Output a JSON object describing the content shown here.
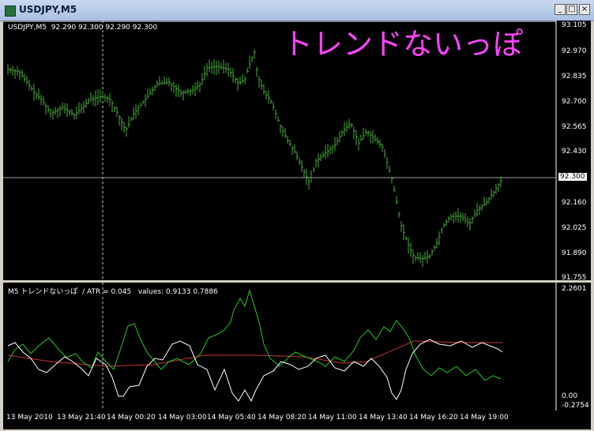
{
  "window": {
    "title": "USDJPY,M5",
    "minimize": "_",
    "maximize": "□",
    "close": "×"
  },
  "main_pane": {
    "symbol_info": "USDJPY,M5",
    "ohlc": "92.290 92.300 92.290 92.300",
    "annotation": "トレンドないっぽ",
    "annotation_color": "#ff44ff",
    "price_labels": [
      "93.105",
      "92.970",
      "92.835",
      "92.700",
      "92.565",
      "92.430",
      "92.300",
      "92.160",
      "92.025",
      "91.890",
      "91.755"
    ],
    "current_price": "92.300",
    "bar_color": "#4aae3a"
  },
  "indicator_pane": {
    "name": "M5 トレンドないっぽ",
    "atr": "/  ATR = 0.045",
    "values": "values: 0.9133 0.7886",
    "scale_labels": [
      "2.2601",
      "0.00",
      "-0.2754"
    ],
    "colors": {
      "green": "#22cc22",
      "white": "#ffffff",
      "red": "#cc3333"
    }
  },
  "time_labels": [
    "13 May 2010",
    "13 May 21:40",
    "14 May 00:20",
    "14 May 03:00",
    "14 May 05:40",
    "14 May 08:20",
    "14 May 11:00",
    "14 May 13:40",
    "14 May 16:20",
    "14 May 19:00"
  ]
}
